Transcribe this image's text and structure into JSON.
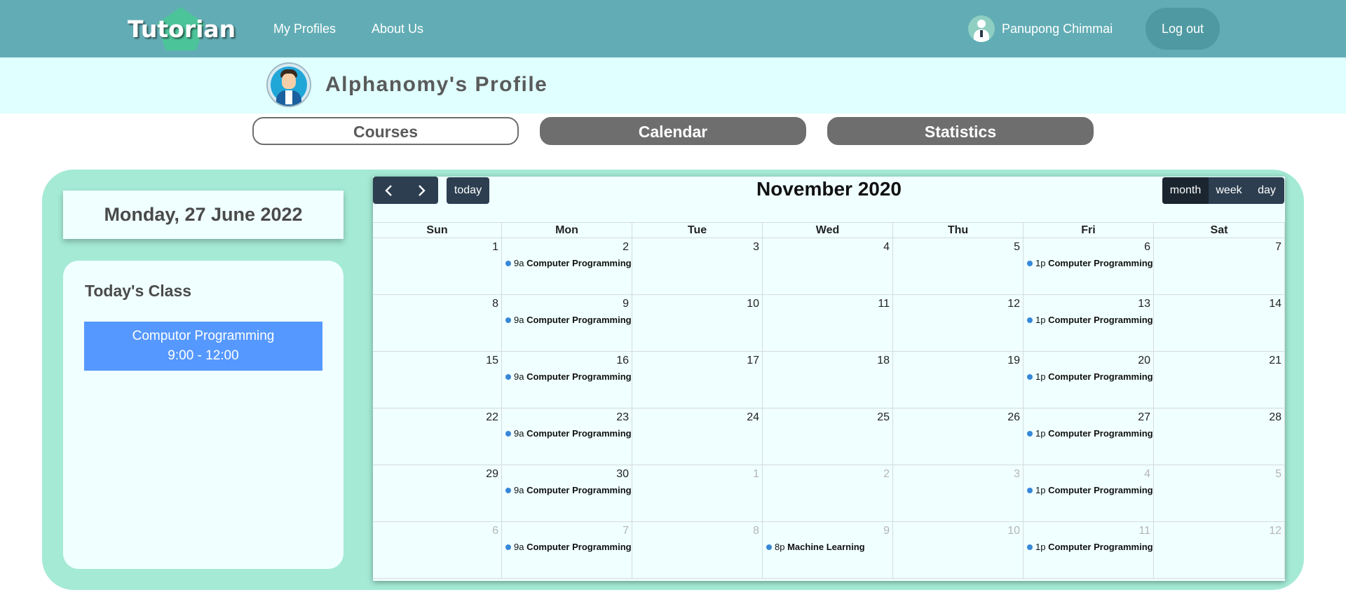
{
  "nav": {
    "logo": "Tutorian",
    "links": [
      "My Profiles",
      "About Us"
    ],
    "user_name": "Panupong Chimmai",
    "logout": "Log out"
  },
  "profile": {
    "title": "Alphanomy's Profile"
  },
  "tabs": [
    "Courses",
    "Calendar",
    "Statistics"
  ],
  "active_tab": "Courses",
  "today": {
    "date": "Monday, 27 June 2022",
    "class_heading": "Today's Class",
    "class_name": "Computor Programming",
    "class_time": "9:00 - 12:00"
  },
  "calendar": {
    "title": "November 2020",
    "prev_icon": "chevron-left-icon",
    "next_icon": "chevron-right-icon",
    "today_label": "today",
    "views": [
      "month",
      "week",
      "day"
    ],
    "active_view": "month",
    "weekdays": [
      "Sun",
      "Mon",
      "Tue",
      "Wed",
      "Thu",
      "Fri",
      "Sat"
    ],
    "event_color": "#3788d8",
    "weeks": [
      [
        {
          "d": "1"
        },
        {
          "d": "2",
          "ev": {
            "time": "9a",
            "title": "Computer Programming"
          }
        },
        {
          "d": "3"
        },
        {
          "d": "4"
        },
        {
          "d": "5"
        },
        {
          "d": "6",
          "ev": {
            "time": "1p",
            "title": "Computer Programming"
          }
        },
        {
          "d": "7"
        }
      ],
      [
        {
          "d": "8"
        },
        {
          "d": "9",
          "ev": {
            "time": "9a",
            "title": "Computer Programming"
          }
        },
        {
          "d": "10"
        },
        {
          "d": "11"
        },
        {
          "d": "12"
        },
        {
          "d": "13",
          "ev": {
            "time": "1p",
            "title": "Computer Programming"
          }
        },
        {
          "d": "14"
        }
      ],
      [
        {
          "d": "15"
        },
        {
          "d": "16",
          "ev": {
            "time": "9a",
            "title": "Computer Programming"
          }
        },
        {
          "d": "17"
        },
        {
          "d": "18"
        },
        {
          "d": "19"
        },
        {
          "d": "20",
          "ev": {
            "time": "1p",
            "title": "Computer Programming"
          }
        },
        {
          "d": "21"
        }
      ],
      [
        {
          "d": "22"
        },
        {
          "d": "23",
          "ev": {
            "time": "9a",
            "title": "Computer Programming"
          }
        },
        {
          "d": "24"
        },
        {
          "d": "25"
        },
        {
          "d": "26"
        },
        {
          "d": "27",
          "ev": {
            "time": "1p",
            "title": "Computer Programming"
          }
        },
        {
          "d": "28"
        }
      ],
      [
        {
          "d": "29"
        },
        {
          "d": "30",
          "ev": {
            "time": "9a",
            "title": "Computer Programming"
          }
        },
        {
          "d": "1",
          "other": true
        },
        {
          "d": "2",
          "other": true
        },
        {
          "d": "3",
          "other": true
        },
        {
          "d": "4",
          "other": true,
          "ev": {
            "time": "1p",
            "title": "Computer Programming"
          }
        },
        {
          "d": "5",
          "other": true
        }
      ],
      [
        {
          "d": "6",
          "other": true
        },
        {
          "d": "7",
          "other": true,
          "ev": {
            "time": "9a",
            "title": "Computer Programming"
          }
        },
        {
          "d": "8",
          "other": true
        },
        {
          "d": "9",
          "other": true,
          "ev": {
            "time": "8p",
            "title": "Machine Learning"
          }
        },
        {
          "d": "10",
          "other": true
        },
        {
          "d": "11",
          "other": true,
          "ev": {
            "time": "1p",
            "title": "Computer Programming"
          }
        },
        {
          "d": "12",
          "other": true
        }
      ]
    ]
  }
}
